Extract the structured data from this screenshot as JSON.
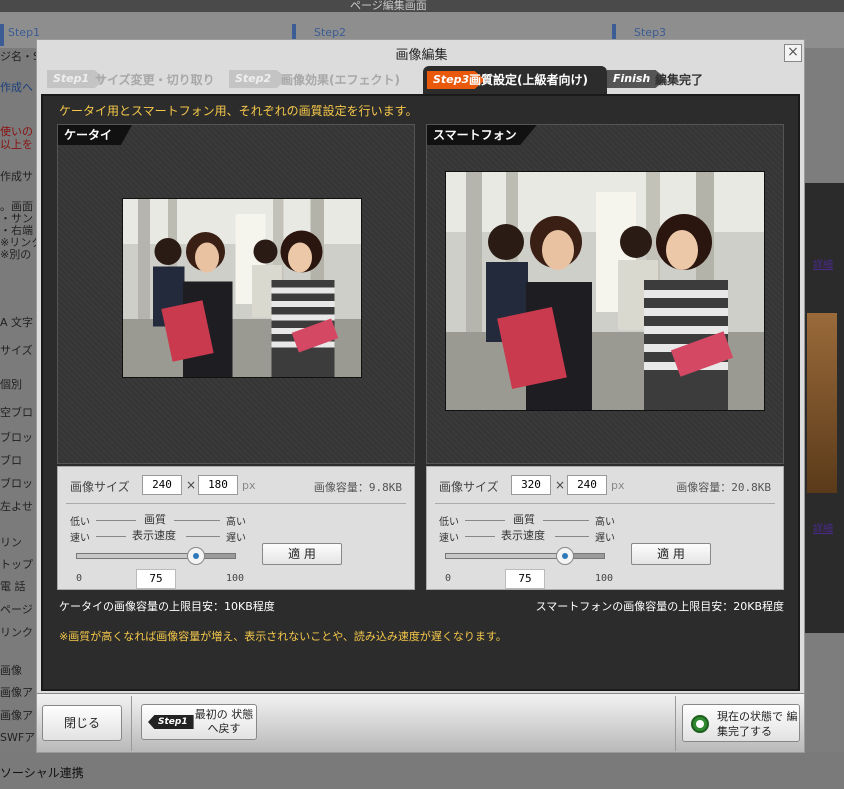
{
  "background": {
    "page_title": "ページ編集画面",
    "steps": [
      "Step1",
      "Step2",
      "Step3"
    ],
    "side_items": [
      {
        "text": "ジ名・S",
        "cls": ""
      },
      {
        "text": "作成へ",
        "cls": "blue"
      },
      {
        "text": "使いの",
        "cls": "red"
      },
      {
        "text": "以上を",
        "cls": "red"
      },
      {
        "text": "作成サ",
        "cls": ""
      },
      {
        "text": "。画面",
        "cls": ""
      },
      {
        "text": "・サン",
        "cls": ""
      },
      {
        "text": "・右端",
        "cls": ""
      },
      {
        "text": "※リンク",
        "cls": ""
      },
      {
        "text": "※別の",
        "cls": ""
      },
      {
        "text": "A 文字",
        "cls": ""
      },
      {
        "text": "サイズ",
        "cls": ""
      },
      {
        "text": "個別",
        "cls": ""
      },
      {
        "text": "空ブロ",
        "cls": ""
      },
      {
        "text": "ブロッ",
        "cls": ""
      },
      {
        "text": "ブロ",
        "cls": ""
      },
      {
        "text": "ブロッ",
        "cls": ""
      },
      {
        "text": "左よせ",
        "cls": ""
      },
      {
        "text": "リン",
        "cls": ""
      },
      {
        "text": "トップ",
        "cls": ""
      },
      {
        "text": "電 話",
        "cls": ""
      },
      {
        "text": "ページ",
        "cls": ""
      },
      {
        "text": "リンク",
        "cls": ""
      },
      {
        "text": "画像",
        "cls": ""
      },
      {
        "text": "画像ア",
        "cls": ""
      },
      {
        "text": "画像ア",
        "cls": ""
      },
      {
        "text": "SWFア",
        "cls": ""
      }
    ],
    "right_links": [
      "詳細",
      "詳細"
    ],
    "bottom_text": "ソーシャル連携"
  },
  "dialog": {
    "title": "画像編集",
    "close": "×",
    "tabs": [
      {
        "step": "Step1",
        "label": "サイズ変更・切り取り"
      },
      {
        "step": "Step2",
        "label": "画像効果(エフェクト)"
      },
      {
        "step": "Step3",
        "label": "画質設定(上級者向け)"
      },
      {
        "step": "Finish",
        "label": "編集完了"
      }
    ],
    "note_top": "ケータイ用とスマートフォン用、それぞれの画質設定を行います。",
    "keitai": {
      "title": "ケータイ",
      "size_label": "画像サイズ",
      "width": "240",
      "height": "180",
      "times": "×",
      "unit": "px",
      "volume": "画像容量：9.8KB",
      "quality_low": "低い",
      "quality_label": "画質",
      "quality_high": "高い",
      "speed_fast": "速い",
      "speed_label": "表示速度",
      "speed_slow": "遅い",
      "apply": "適 用",
      "min": "0",
      "value": "75",
      "max": "100",
      "slider_value": 75,
      "limit": "ケータイの画像容量の上限目安：10KB程度"
    },
    "smartphone": {
      "title": "スマートフォン",
      "size_label": "画像サイズ",
      "width": "320",
      "height": "240",
      "times": "×",
      "unit": "px",
      "volume": "画像容量：20.8KB",
      "quality_low": "低い",
      "quality_label": "画質",
      "quality_high": "高い",
      "speed_fast": "速い",
      "speed_label": "表示速度",
      "speed_slow": "遅い",
      "apply": "適 用",
      "min": "0",
      "value": "75",
      "max": "100",
      "slider_value": 75,
      "limit": "スマートフォンの画像容量の上限目安：20KB程度"
    },
    "warning": "※画質が高くなれば画像容量が増え、表示されないことや、読み込み速度が遅くなります。",
    "footer": {
      "close": "閉じる",
      "reset_step": "Step1",
      "reset_label": "最初の 状態へ戻す",
      "finish_label": "現在の状態で 編集完了する"
    }
  },
  "colors": {
    "accent": "#e8590c",
    "note": "#f5c84a",
    "dark_bg": "#2c2c2c",
    "finish_green": "#2f8a2f"
  }
}
